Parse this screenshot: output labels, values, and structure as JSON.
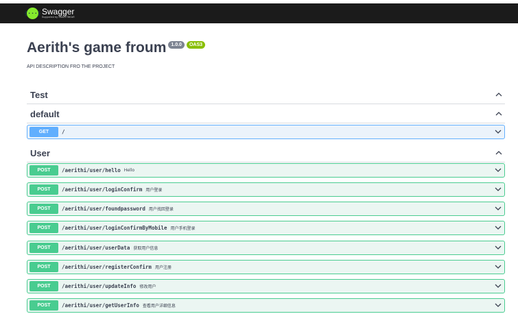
{
  "header": {
    "logo_name": "Swagger",
    "logo_sub": "Supported by SMARTBEAR",
    "logo_mark": "{···}"
  },
  "info": {
    "title": "Aerith's game froum",
    "version_badge": "1.0.0",
    "oas_badge": "OAS3",
    "description": "API DESCRIPTION FRO THE PROJECT"
  },
  "tags": {
    "test": {
      "name": "Test",
      "chevron": "^"
    },
    "default": {
      "name": "default",
      "chevron": "^"
    },
    "user": {
      "name": "User",
      "chevron": "^"
    }
  },
  "operations": {
    "default": [
      {
        "method": "GET",
        "path": "/",
        "summary": ""
      }
    ],
    "user": [
      {
        "method": "POST",
        "path": "/aerithi/user/hello",
        "summary": "Hello"
      },
      {
        "method": "POST",
        "path": "/aerithi/user/loginConfirm",
        "summary": "用户登录"
      },
      {
        "method": "POST",
        "path": "/aerithi/user/foundpassword",
        "summary": "用户找回登录"
      },
      {
        "method": "POST",
        "path": "/aerithi/user/loginConfirmByMobile",
        "summary": "用户手机登录"
      },
      {
        "method": "POST",
        "path": "/aerithi/user/userData",
        "summary": "获取用户信息"
      },
      {
        "method": "POST",
        "path": "/aerithi/user/registerConfirm",
        "summary": "用户注册"
      },
      {
        "method": "POST",
        "path": "/aerithi/user/updateInfo",
        "summary": "修改用户"
      },
      {
        "method": "POST",
        "path": "/aerithi/user/getUserInfo",
        "summary": "查看用户详细信息"
      }
    ]
  },
  "colors": {
    "topbar": "#1b1b1b",
    "post": "#49cc90",
    "get": "#61affe",
    "version_badge": "#7d8492",
    "oas_badge": "#89bf04"
  }
}
